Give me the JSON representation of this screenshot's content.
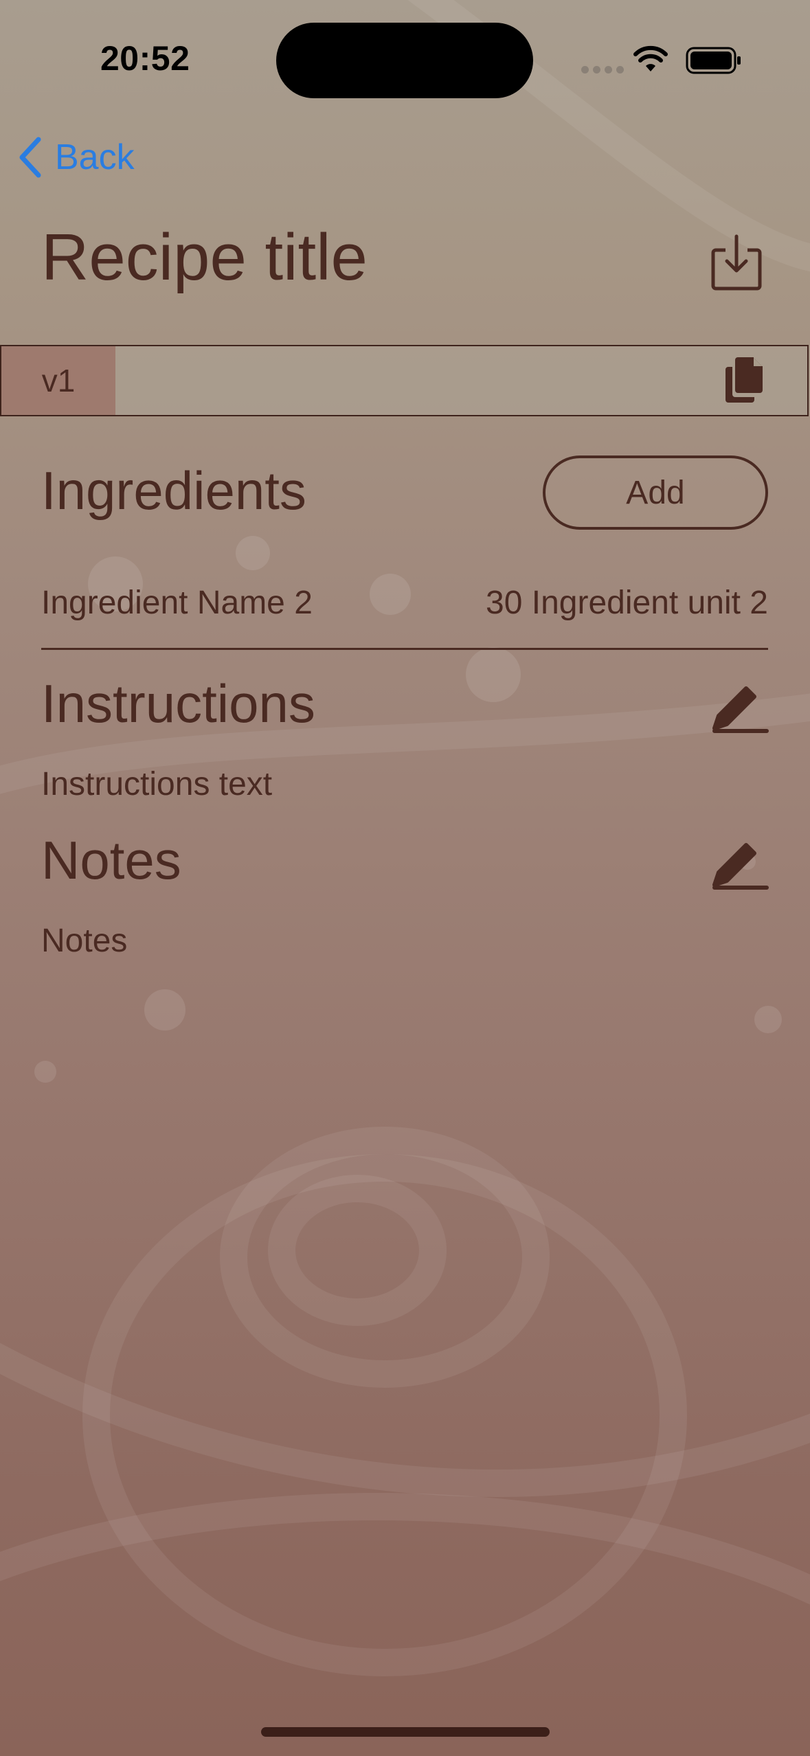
{
  "status_bar": {
    "time": "20:52"
  },
  "nav": {
    "back_label": "Back",
    "back_icon": "chevron-left-icon"
  },
  "header": {
    "title": "Recipe title",
    "export_icon": "tray-arrow-down-icon"
  },
  "versions": {
    "tabs": [
      {
        "label": "v1",
        "selected": true
      }
    ],
    "copy_icon": "copy-icon"
  },
  "ingredients": {
    "heading": "Ingredients",
    "add_label": "Add",
    "items": [
      {
        "name": "Ingredient Name 2",
        "amount": "30 Ingredient unit 2"
      }
    ]
  },
  "instructions": {
    "heading": "Instructions",
    "text": "Instructions text",
    "edit_icon": "pencil-icon"
  },
  "notes": {
    "heading": "Notes",
    "text": "Notes",
    "edit_icon": "pencil-icon"
  },
  "colors": {
    "accent_link": "#2a7de1",
    "text_primary": "#4a2a22",
    "selected_tab": "#9e7a6e"
  }
}
